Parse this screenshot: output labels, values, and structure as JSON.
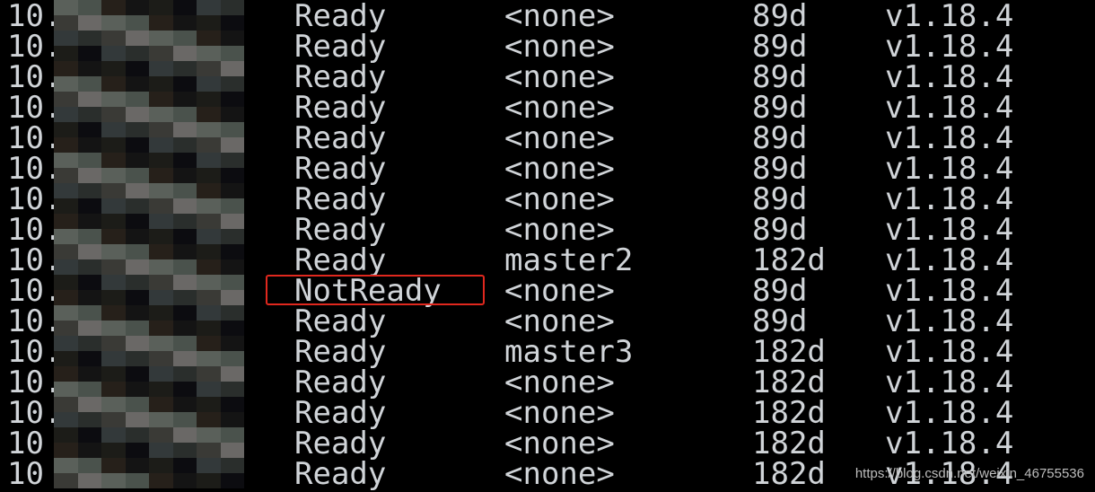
{
  "terminal": {
    "rows": [
      {
        "ip": "10.",
        "status": "Ready",
        "roles": "<none>",
        "age": "89d",
        "version": "v1.18.4"
      },
      {
        "ip": "10.",
        "status": "Ready",
        "roles": "<none>",
        "age": "89d",
        "version": "v1.18.4"
      },
      {
        "ip": "10.",
        "status": "Ready",
        "roles": "<none>",
        "age": "89d",
        "version": "v1.18.4"
      },
      {
        "ip": "10.",
        "status": "Ready",
        "roles": "<none>",
        "age": "89d",
        "version": "v1.18.4"
      },
      {
        "ip": "10.",
        "status": "Ready",
        "roles": "<none>",
        "age": "89d",
        "version": "v1.18.4"
      },
      {
        "ip": "10.",
        "status": "Ready",
        "roles": "<none>",
        "age": "89d",
        "version": "v1.18.4"
      },
      {
        "ip": "10.",
        "status": "Ready",
        "roles": "<none>",
        "age": "89d",
        "version": "v1.18.4"
      },
      {
        "ip": "10.",
        "status": "Ready",
        "roles": "<none>",
        "age": "89d",
        "version": "v1.18.4"
      },
      {
        "ip": "10.",
        "status": "Ready",
        "roles": "master2",
        "age": "182d",
        "version": "v1.18.4"
      },
      {
        "ip": "10.",
        "status": "NotReady",
        "roles": "<none>",
        "age": "89d",
        "version": "v1.18.4"
      },
      {
        "ip": "10.",
        "status": "Ready",
        "roles": "<none>",
        "age": "89d",
        "version": "v1.18.4"
      },
      {
        "ip": "10.",
        "status": "Ready",
        "roles": "master3",
        "age": "182d",
        "version": "v1.18.4"
      },
      {
        "ip": "10.",
        "status": "Ready",
        "roles": "<none>",
        "age": "182d",
        "version": "v1.18.4"
      },
      {
        "ip": "10.",
        "status": "Ready",
        "roles": "<none>",
        "age": "182d",
        "version": "v1.18.4"
      },
      {
        "ip": "10",
        "status": "Ready",
        "roles": "<none>",
        "age": "182d",
        "version": "v1.18.4"
      },
      {
        "ip": "10",
        "status": "Ready",
        "roles": "<none>",
        "age": "182d",
        "version": "v1.18.4"
      }
    ],
    "highlight_color": "#e0281e"
  },
  "watermark": "https://blog.csdn.net/weixin_46755536"
}
